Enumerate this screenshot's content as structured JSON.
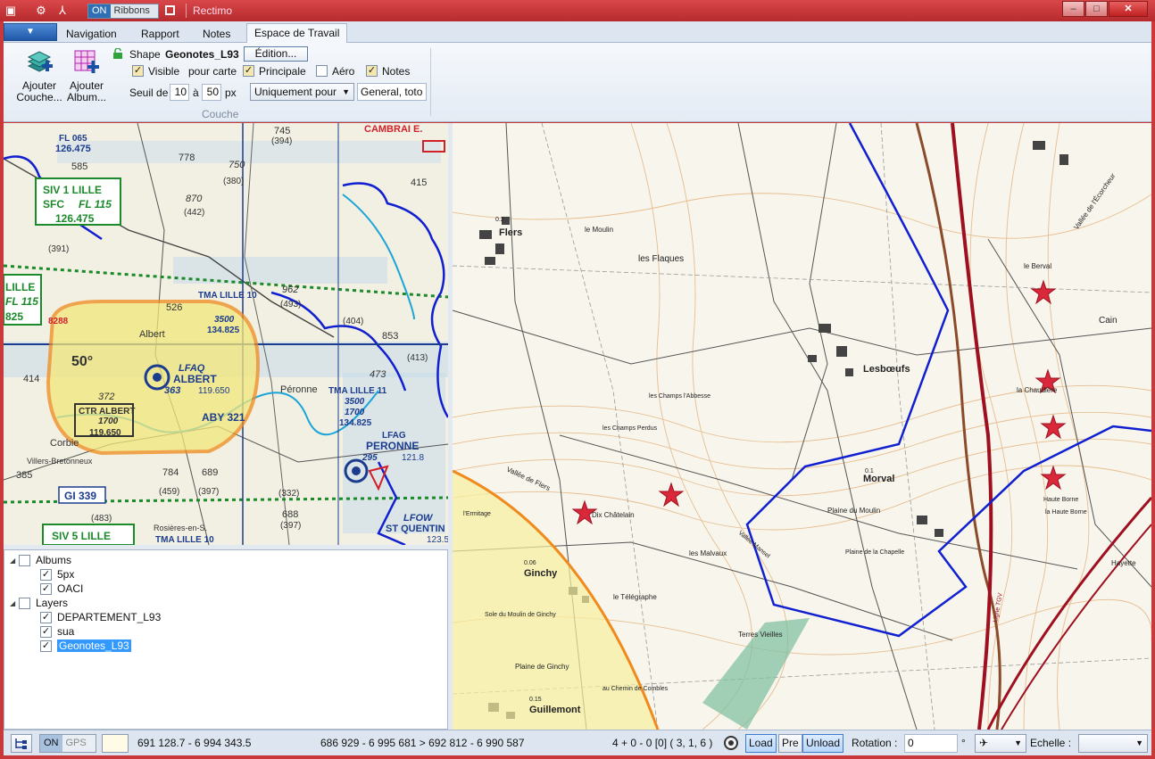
{
  "window": {
    "title": "Rectimo",
    "on_label": "ON",
    "ribbons_label": "Ribbons",
    "minimize": "–",
    "maximize": "□",
    "close": "✕"
  },
  "ribbon": {
    "tabs": [
      "Navigation",
      "Rapport",
      "Notes",
      "Espace de Travail"
    ],
    "active_tab": "Espace de Travail",
    "add_layer": "Ajouter Couche...",
    "add_album": "Ajouter Album...",
    "shape_label": "Shape",
    "shape_name": "Geonotes_L93",
    "edit_button": "Édition...",
    "visible_label": "Visible",
    "pour_carte_label": "pour carte",
    "principale_label": "Principale",
    "aero_label": "Aéro",
    "notes_label": "Notes",
    "seuil_label": "Seuil de",
    "seuil_from": "10",
    "a_label": "à",
    "seuil_to": "50",
    "px_label": "px",
    "mode_select": "Uniquement pour",
    "mode_value": "General, toto",
    "group_label": "Couche",
    "checks": {
      "visible": true,
      "principale": true,
      "aero": false,
      "notes": true
    }
  },
  "aero_map": {
    "labels": [
      "FL 065",
      "126.475",
      "585",
      "SIV 1 LILLE",
      "SFC",
      "FL 115",
      "126.475",
      "CAMBRAI E.",
      "LILLE",
      "FL 115",
      "825",
      "8288",
      "526",
      "Albert",
      "50°",
      "LFAQ",
      "ALBERT",
      "363",
      "119.650",
      "CTR ALBERT",
      "1700",
      "119.650",
      "ABY 321",
      "414",
      "372",
      "Péronne",
      "TMA LILLE 11",
      "3500",
      "1700",
      "134.825",
      "LFAG",
      "PERONNE",
      "295",
      "121.8",
      "Corbie",
      "385",
      "GI 339",
      "784",
      "689",
      "SIV 5 LILLE",
      "TMA LILLE 10",
      "688",
      "(397)",
      "LFOW",
      "ST QUENTIN",
      "123.5",
      "962",
      "(493)",
      "853",
      "473",
      "745",
      "(394)",
      "778",
      "870",
      "(442)",
      "750",
      "(380)",
      "415",
      "(391)",
      "TMA LILLE 10",
      "3500",
      "134.825",
      "(404)",
      "(413)",
      "(459)",
      "(397)",
      "(332)",
      "(483)",
      "Villers-Bretonneux",
      "Rosières-en-S."
    ]
  },
  "topo_map": {
    "labels": [
      "Flers",
      "les Flaques",
      "le Moulin",
      "Lesbœufs",
      "Morval",
      "Ginchy",
      "Guillemont",
      "la Chaudière",
      "Cain",
      "le Berval",
      "Vallée de l'Écorcheur",
      "Dix Châtelain",
      "les Malvaux",
      "le Télégraphe",
      "Plaine du Moulin",
      "Plaine de la Chapelle",
      "Vallée Mansel",
      "Terres Vieilles",
      "Haute Borne",
      "Hayette",
      "Ligne TGV",
      "les Champs Perdus",
      "les Champs l'Abbesse",
      "la Haute Borne",
      "Plaine de Ginchy",
      "au Chemin de Combles",
      "Sole du Moulin de Ginchy",
      "l'Ermitage",
      "0.2",
      "0.1",
      "0.06",
      "0.15",
      "Vallée de Flers"
    ]
  },
  "tree": {
    "albums_label": "Albums",
    "albums": [
      {
        "label": "5px",
        "checked": true
      },
      {
        "label": "OACI",
        "checked": true
      }
    ],
    "layers_label": "Layers",
    "layers": [
      {
        "label": "DEPARTEMENT_L93",
        "checked": true
      },
      {
        "label": "sua",
        "checked": true
      },
      {
        "label": "Geonotes_L93",
        "checked": true,
        "selected": true
      }
    ]
  },
  "status": {
    "on_label": "ON",
    "gps_label": "GPS",
    "position": "691 128.7 - 6 994 343.5",
    "extent": "686 929 - 6 995 681 >  692 812 - 6 990 587",
    "counts": "4 + 0 - 0 [0]  ( 3, 1, 6 )",
    "load": "Load",
    "pre": "Pre",
    "unload": "Unload",
    "rotation_label": "Rotation :",
    "rotation_value": "0",
    "degree": "°",
    "echelle_label": "Echelle :",
    "echelle_value": ""
  },
  "colors": {
    "title_bar": "#c9393c",
    "ribbon_bg": "#e4ebf4",
    "route_blue": "#1020d0",
    "ctr_yellow": "#f3e77a",
    "ctr_orange": "#f08a1c",
    "star_red": "#d8283a"
  }
}
